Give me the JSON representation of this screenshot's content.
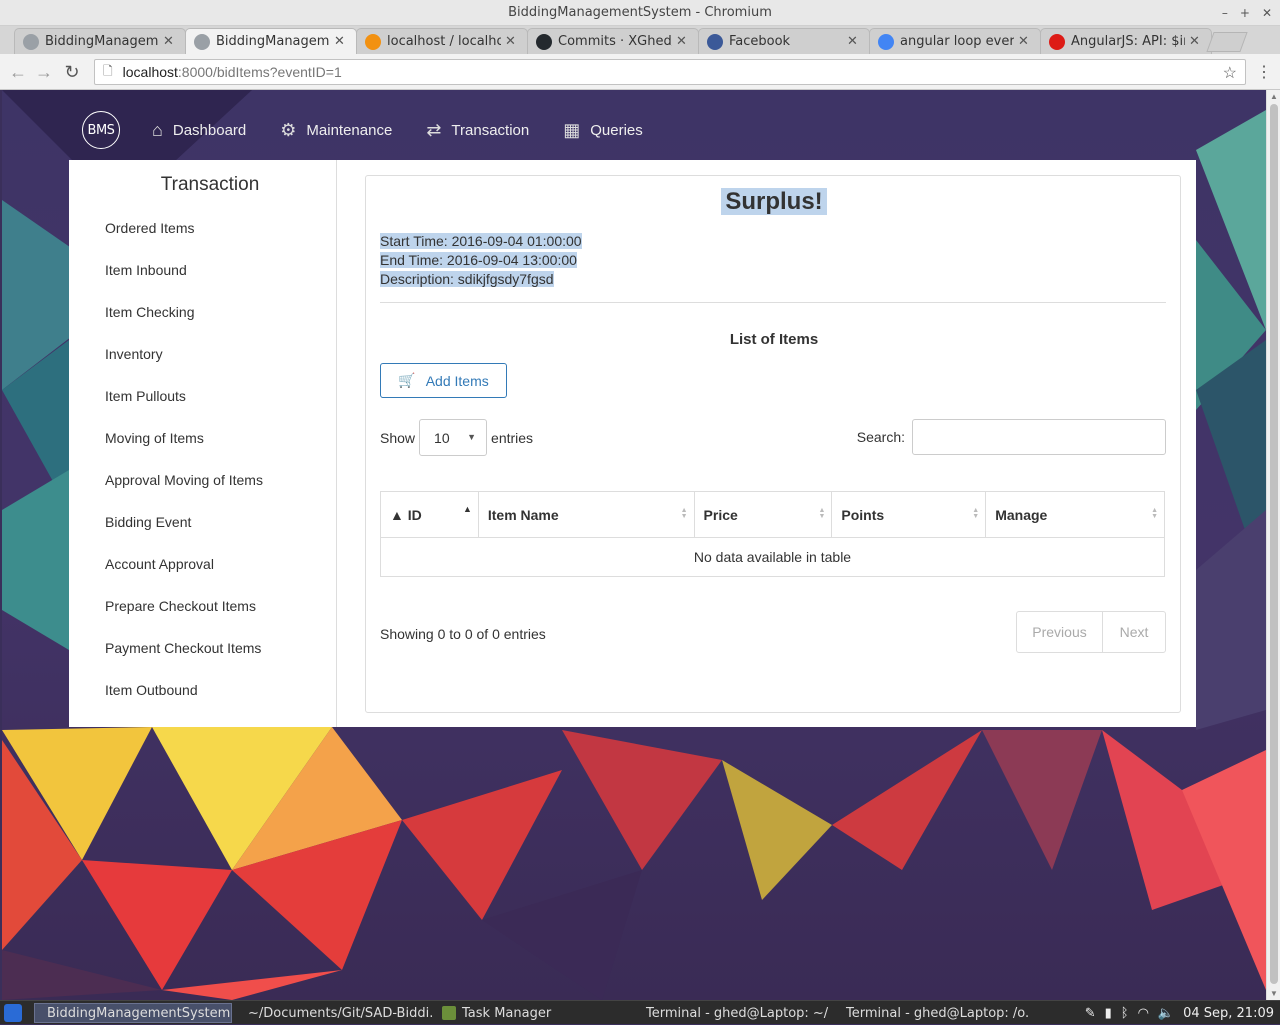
{
  "window": {
    "title": "BiddingManagementSystem - Chromium",
    "controls": [
      "–",
      "+",
      "✕"
    ]
  },
  "tabs": [
    {
      "label": "BiddingManageme",
      "favicon": "chromium-icon",
      "color": "#9aa0a6",
      "active": false
    },
    {
      "label": "BiddingManageme",
      "favicon": "chromium-icon",
      "color": "#9aa0a6",
      "active": true
    },
    {
      "label": "localhost / localhost",
      "favicon": "phpmyadmin-icon",
      "color": "#f29111",
      "active": false
    },
    {
      "label": "Commits · XGhed/S",
      "favicon": "github-icon",
      "color": "#24292e",
      "active": false
    },
    {
      "label": "Facebook",
      "favicon": "facebook-icon",
      "color": "#3b5998",
      "active": false
    },
    {
      "label": "angular loop every",
      "favicon": "google-icon",
      "color": "#4285f4",
      "active": false
    },
    {
      "label": "AngularJS: API: $int",
      "favicon": "angular-icon",
      "color": "#dd1b16",
      "active": false
    }
  ],
  "address": {
    "host": "localhost",
    "path": ":8000/bidItems?eventID=1"
  },
  "nav": {
    "logo": "BMS",
    "links": [
      {
        "label": "Dashboard",
        "icon": "home-icon"
      },
      {
        "label": "Maintenance",
        "icon": "gears-icon"
      },
      {
        "label": "Transaction",
        "icon": "exchange-icon"
      },
      {
        "label": "Queries",
        "icon": "calendar-icon"
      }
    ]
  },
  "sidebar": {
    "title": "Transaction",
    "items": [
      "Ordered Items",
      "Item Inbound",
      "Item Checking",
      "Inventory",
      "Item Pullouts",
      "Moving of Items",
      "Approval Moving of Items",
      "Bidding Event",
      "Account Approval",
      "Prepare Checkout Items",
      "Payment Checkout Items",
      "Item Outbound"
    ]
  },
  "event": {
    "title": "Surplus!",
    "start": "Start Time: 2016-09-04 01:00:00",
    "end": "End Time: 2016-09-04 13:00:00",
    "description": "Description: sdikjfgsdy7fgsd"
  },
  "list": {
    "title": "List of Items",
    "add_button": "Add Items",
    "show_label": "Show",
    "page_length": "10",
    "entries_label": "entries",
    "search_label": "Search:",
    "search_value": "",
    "columns": [
      "ID",
      "Item Name",
      "Price",
      "Points",
      "Manage"
    ],
    "empty_message": "No data available in table",
    "info": "Showing 0 to 0 of 0 entries",
    "prev": "Previous",
    "next": "Next"
  },
  "taskbar": {
    "items": [
      {
        "label": "BiddingManagementSystem...",
        "active": true
      },
      {
        "label": "~/Documents/Git/SAD-Biddi...",
        "active": false
      },
      {
        "label": "Task Manager",
        "active": false
      },
      {
        "label": "Terminal - ghed@Laptop: ~/...",
        "active": false
      },
      {
        "label": "Terminal - ghed@Laptop: /o...",
        "active": false
      }
    ],
    "clock": "04 Sep, 21:09"
  },
  "colors": {
    "accent": "#337ab7",
    "highlight": "#bed4ec"
  }
}
